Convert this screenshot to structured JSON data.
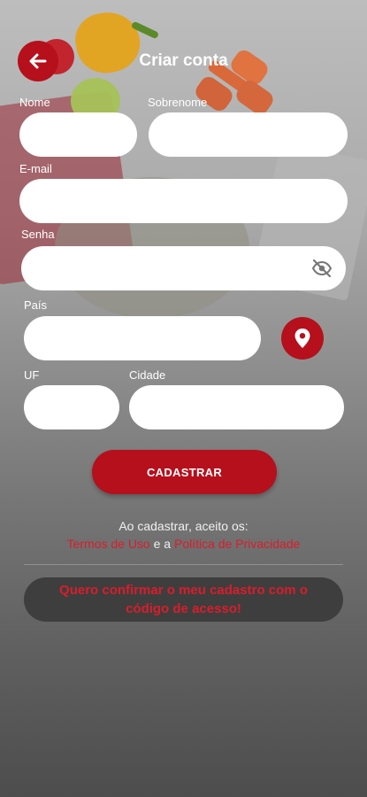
{
  "header": {
    "title": "Criar conta",
    "back_icon": "arrow-left-icon"
  },
  "form": {
    "nome_label": "Nome",
    "sobrenome_label": "Sobrenome",
    "email_label": "E-mail",
    "senha_label": "Senha",
    "pais_label": "País",
    "uf_label": "UF",
    "cidade_label": "Cidade",
    "nome_value": "",
    "sobrenome_value": "",
    "email_value": "",
    "senha_value": "",
    "pais_value": "",
    "uf_value": "",
    "cidade_value": "",
    "password_toggle_icon": "eye-off-icon",
    "location_icon": "map-pin-icon"
  },
  "actions": {
    "submit_label": "CADASTRAR",
    "confirm_label": "Quero confirmar o meu cadastro com o código de acesso!"
  },
  "terms": {
    "line1": "Ao cadastrar, aceito os:",
    "terms_link": "Termos de Uso",
    "connector": " e a ",
    "privacy_link": "Política de Privacidade"
  },
  "colors": {
    "accent": "#b5101c",
    "link": "#d91d2b"
  }
}
